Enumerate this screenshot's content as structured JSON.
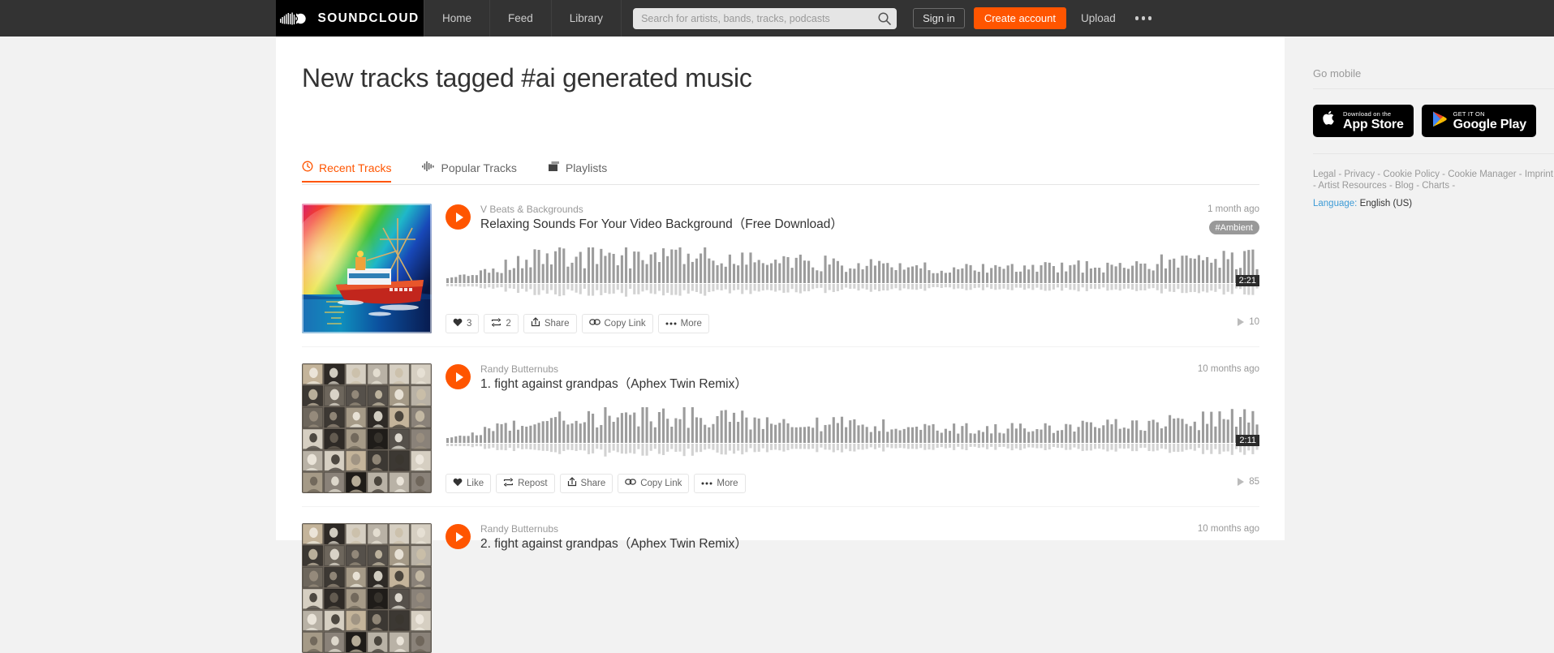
{
  "header": {
    "logo_text": "SOUNDCLOUD",
    "logo_icon": "soundcloud-logo-icon",
    "nav": [
      {
        "label": "Home",
        "name": "nav-home"
      },
      {
        "label": "Feed",
        "name": "nav-feed"
      },
      {
        "label": "Library",
        "name": "nav-library"
      }
    ],
    "search": {
      "placeholder": "Search for artists, bands, tracks, podcasts",
      "value": "",
      "icon": "search-icon"
    },
    "sign_in_label": "Sign in",
    "create_account_label": "Create account",
    "upload_label": "Upload",
    "overflow_icon": "ellipsis-icon",
    "accent_color": "#ff5500",
    "bar_color": "#333333"
  },
  "main": {
    "page_title": "New tracks tagged #ai generated music",
    "tabs": [
      {
        "label": "Recent Tracks",
        "icon": "clock-icon",
        "active": true
      },
      {
        "label": "Popular Tracks",
        "icon": "waveform-icon",
        "active": false
      },
      {
        "label": "Playlists",
        "icon": "playlist-stack-icon",
        "active": false
      }
    ],
    "tracks": [
      {
        "artist": "V Beats & Backgrounds",
        "title": "Relaxing Sounds For Your Video Background（Free Download）",
        "time_ago": "1 month ago",
        "tag": "#Ambient",
        "duration": "2:21",
        "artwork": "ship-rainbow-painting",
        "play_icon": "play-icon",
        "actions": [
          {
            "label": "3",
            "icon": "heart-icon",
            "name": "like-button"
          },
          {
            "label": "2",
            "icon": "repost-icon",
            "name": "repost-button"
          },
          {
            "label": "Share",
            "icon": "share-icon",
            "name": "share-button"
          },
          {
            "label": "Copy Link",
            "icon": "link-icon",
            "name": "copy-link-button"
          },
          {
            "label": "More",
            "icon": "ellipsis-icon",
            "name": "more-button"
          }
        ],
        "play_count": "10"
      },
      {
        "artist": "Randy Butternubs",
        "title": "1. fight against grandpas（Aphex Twin Remix）",
        "time_ago": "10 months ago",
        "tag": "",
        "duration": "2:11",
        "artwork": "portrait-grid",
        "play_icon": "play-icon",
        "actions": [
          {
            "label": "Like",
            "icon": "heart-icon",
            "name": "like-button"
          },
          {
            "label": "Repost",
            "icon": "repost-icon",
            "name": "repost-button"
          },
          {
            "label": "Share",
            "icon": "share-icon",
            "name": "share-button"
          },
          {
            "label": "Copy Link",
            "icon": "link-icon",
            "name": "copy-link-button"
          },
          {
            "label": "More",
            "icon": "ellipsis-icon",
            "name": "more-button"
          }
        ],
        "play_count": "85"
      },
      {
        "artist": "Randy Butternubs",
        "title": "2. fight against grandpas（Aphex Twin Remix）",
        "time_ago": "10 months ago",
        "tag": "",
        "duration": "",
        "artwork": "portrait-grid",
        "play_icon": "play-icon",
        "actions": [],
        "play_count": ""
      }
    ]
  },
  "sidebar": {
    "go_mobile_label": "Go mobile",
    "app_store": {
      "small": "Download on the",
      "big": "App Store",
      "icon": "apple-icon"
    },
    "google_play": {
      "small": "GET IT ON",
      "big": "Google Play",
      "icon": "google-play-icon"
    },
    "footer_links": [
      "Legal",
      "Privacy",
      "Cookie Policy",
      "Cookie Manager",
      "Imprint",
      "Artist Resources",
      "Blog",
      "Charts"
    ],
    "language_label": "Language:",
    "language_value": "English (US)"
  }
}
